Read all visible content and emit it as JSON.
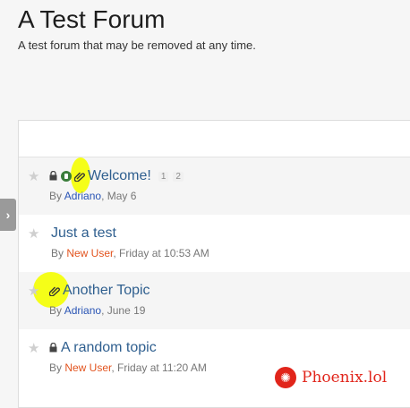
{
  "forum": {
    "title": "A Test Forum",
    "description": "A test forum that may be removed at any time."
  },
  "topics": [
    {
      "title": "Welcome!",
      "by": "By ",
      "author": "Adriano",
      "date": ", May 6",
      "pages": [
        "1",
        "2"
      ]
    },
    {
      "title": "Just a test",
      "by": "By ",
      "author": "New User",
      "date": ", Friday at 10:53 AM"
    },
    {
      "title": "Another Topic",
      "by": "By ",
      "author": "Adriano",
      "date": ", June 19"
    },
    {
      "title": "A random topic",
      "by": "By ",
      "author": "New User",
      "date": ", Friday at 11:20 AM"
    }
  ],
  "watermark": {
    "brand": "Phoenix.lol"
  },
  "icons": {
    "star": "star-icon",
    "lock": "lock-icon",
    "sticky": "sticky-icon",
    "attachment": "paperclip-icon",
    "sidebar_toggle": "chevron-right-icon"
  },
  "colors": {
    "link": "#2f5f8f",
    "author_blue": "#2a55b5",
    "author_red": "#e2541f",
    "highlight": "#f5ff00",
    "watermark": "#e1251b"
  }
}
